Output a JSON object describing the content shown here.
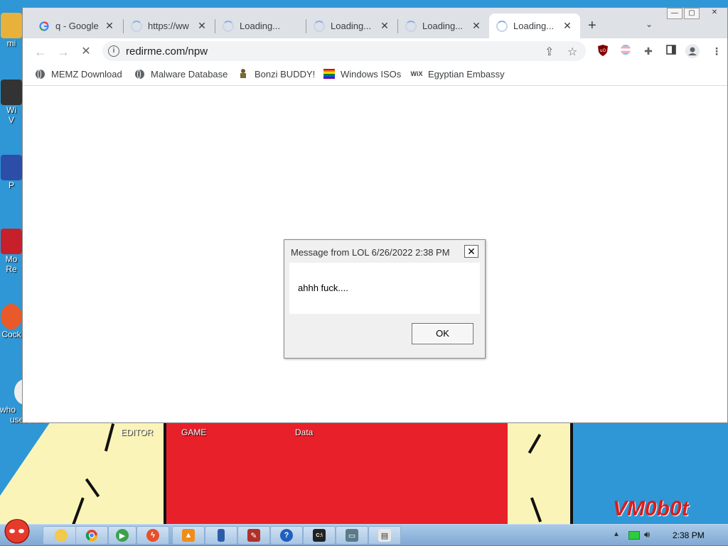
{
  "browser": {
    "tabs": [
      {
        "title": "q - Google",
        "favicon": "google-g-icon",
        "state": "normal"
      },
      {
        "title": "https://ww",
        "favicon": "spinner-icon",
        "state": "loading"
      },
      {
        "title": "Loading...",
        "favicon": "spinner-icon",
        "state": "loading"
      },
      {
        "title": "Loading...",
        "favicon": "spinner-icon",
        "state": "loading"
      },
      {
        "title": "Loading...",
        "favicon": "spinner-icon",
        "state": "loading"
      },
      {
        "title": "Loading...",
        "favicon": "spinner-icon",
        "state": "active-loading"
      }
    ],
    "new_tab_symbol": "+",
    "tab_search_symbol": "⌄",
    "window_controls": {
      "minimize": "—",
      "restore": "▢",
      "close": "✕"
    },
    "toolbar": {
      "back": "←",
      "forward": "→",
      "stop": "✕",
      "url": "redirme.com/npw",
      "info_symbol": "i"
    },
    "bookmarks": [
      {
        "label": "MEMZ Download",
        "icon": "globe-icon"
      },
      {
        "label": "Malware Database",
        "icon": "globe-icon"
      },
      {
        "label": "Bonzi BUDDY!",
        "icon": "bonzi-icon"
      },
      {
        "label": "Windows ISOs",
        "icon": "rainbow-flag-icon"
      },
      {
        "label": "Egyptian Embassy",
        "icon": "wix-icon",
        "icon_text": "WiX"
      }
    ],
    "extensions": [
      "ublock-icon",
      "pride-flag-icon",
      "puzzle-icon",
      "sidebar-icon",
      "profile-icon",
      "menu-icon"
    ]
  },
  "dialog": {
    "title": "Message from LOL 6/26/2022 2:38 PM",
    "message": "ahhh fuck....",
    "ok_label": "OK",
    "close_symbol": "✕"
  },
  "desktop": {
    "icons": [
      {
        "label": "mi",
        "color": "#e8b13a"
      },
      {
        "label": "Wi",
        "label2": "V",
        "color": "#333333"
      },
      {
        "label": "P",
        "color": "#2c4ea8"
      },
      {
        "label": "Mo",
        "label2": "Re",
        "color": "#c8202a"
      },
      {
        "label": "Cock",
        "color": "#e85a2a"
      },
      {
        "label": "who",
        "label2": "uses this",
        "color": "#eeeeee"
      }
    ],
    "wallpaper_labels": [
      "EDITOR",
      "GAME",
      "Data"
    ],
    "watermark": "VM0b0t"
  },
  "taskbar": {
    "items": [
      {
        "name": "explorer",
        "color": "#f2c94c",
        "glyph": ""
      },
      {
        "name": "chrome",
        "color": "#4c8bf5",
        "glyph": ""
      },
      {
        "name": "media-player",
        "color": "#3aa24a",
        "glyph": "▶"
      },
      {
        "name": "flash",
        "color": "#e8502a",
        "glyph": "ϟ"
      },
      {
        "name": "vlc",
        "color": "#f08c1a",
        "glyph": "▲"
      },
      {
        "name": "phone",
        "color": "#2b5ca8",
        "glyph": ""
      },
      {
        "name": "tools",
        "color": "#b0302a",
        "glyph": "✎"
      },
      {
        "name": "help",
        "color": "#1f5fbf",
        "glyph": "?"
      },
      {
        "name": "cmd",
        "color": "#222222",
        "glyph": "C:\\"
      },
      {
        "name": "monitor",
        "color": "#5a7a8a",
        "glyph": "▭"
      },
      {
        "name": "window",
        "color": "#e8e8e8",
        "glyph": "▤"
      }
    ],
    "clock": "2:38 PM"
  }
}
